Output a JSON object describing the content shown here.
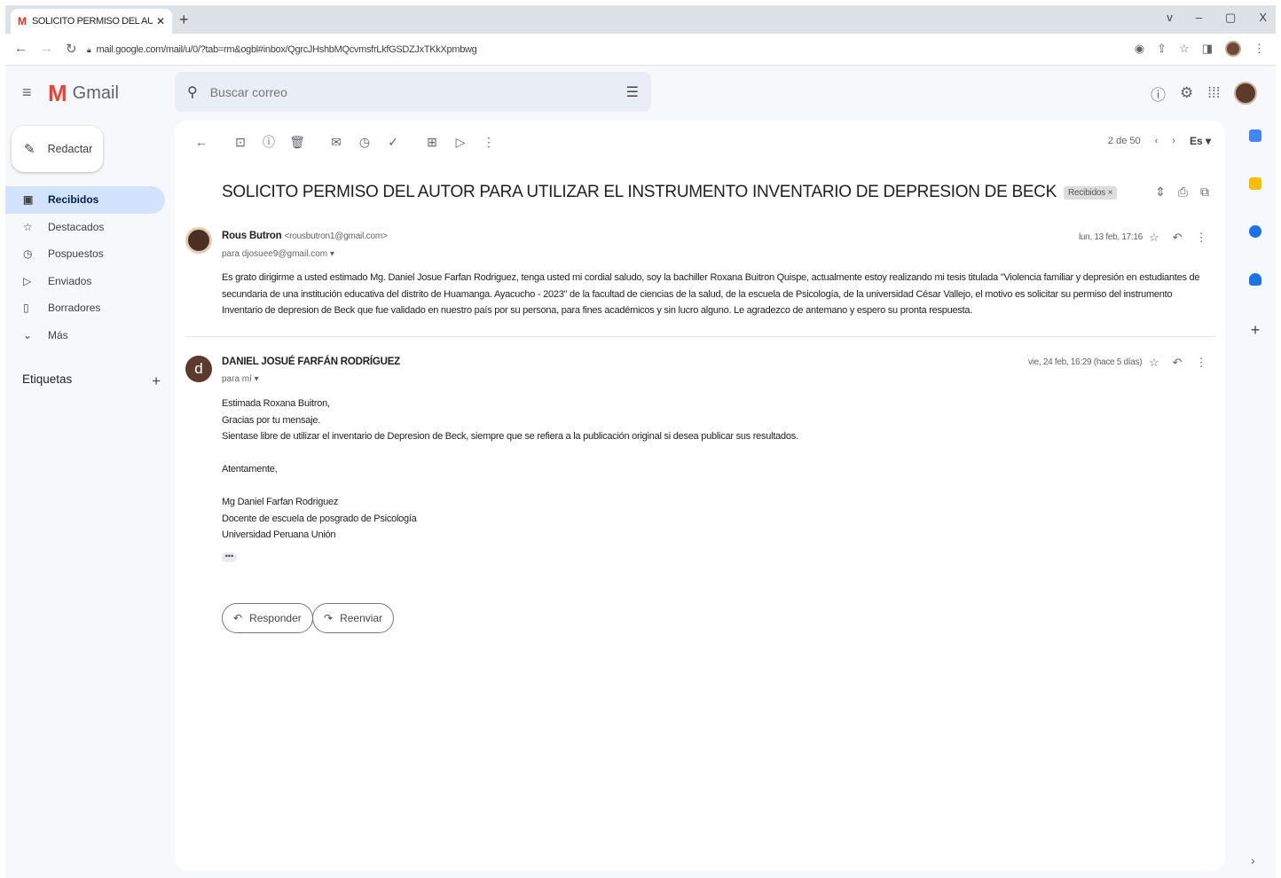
{
  "browser": {
    "tab_title": "SOLICITO PERMISO DEL AUTOR P",
    "tab_favicon": "M",
    "new_tab": "+",
    "url": "mail.google.com/mail/u/0/?tab=rm&ogbl#inbox/QgrcJHshbMQcvmsfrLkfGSDZJxTKkXpmbwg",
    "window_controls": [
      "v",
      "–",
      "▢",
      "X"
    ]
  },
  "gmail": {
    "logo_text": "Gmail",
    "search_placeholder": "Buscar correo",
    "compose_label": "Redactar"
  },
  "nav": [
    {
      "label": "Recibidos",
      "icon": "inbox-icon",
      "glyph": "▣",
      "active": true
    },
    {
      "label": "Destacados",
      "icon": "star-icon",
      "glyph": "☆"
    },
    {
      "label": "Pospuestos",
      "icon": "clock-icon",
      "glyph": "◷"
    },
    {
      "label": "Enviados",
      "icon": "send-icon",
      "glyph": "▷"
    },
    {
      "label": "Borradores",
      "icon": "draft-icon",
      "glyph": "▯"
    },
    {
      "label": "Más",
      "icon": "chevron-down-icon",
      "glyph": "⌄"
    }
  ],
  "labels_heading": "Etiquetas",
  "pager": {
    "text": "2 de 50",
    "lang": "Es ▾"
  },
  "thread": {
    "subject": "SOLICITO PERMISO DEL AUTOR PARA UTILIZAR EL INSTRUMENTO INVENTARIO DE DEPRESION DE BECK",
    "badge": "Recibidos ×",
    "messages": [
      {
        "sender": "Rous Butron",
        "email": "<rousbutron1@gmail.com>",
        "to": "para djosuee9@gmail.com ▾",
        "date": "lun, 13 feb, 17:16",
        "body": "Es grato dirigirme a usted estimado Mg. Daniel Josue Farfan Rodriguez, tenga usted mi cordial saludo, soy la bachiller Roxana Buitron Quispe, actualmente estoy realizando mi tesis titulada \"Violencia familiar y depresión en estudiantes de secundaria de una institución educativa del distrito de Huamanga. Ayacucho - 2023\" de la facultad de ciencias de la salud, de la escuela de Psicología, de la universidad César Vallejo, el motivo es solicitar su permiso del instrumento Inventario de depresion de Beck que fue validado en nuestro país por su persona, para fines académicos y sin lucro alguno. Le agradezco de antemano y espero su pronta respuesta."
      },
      {
        "avatar_letter": "d",
        "sender": "DANIEL JOSUÉ FARFÁN RODRÍGUEZ",
        "to": "para mí ▾",
        "date": "vie, 24 feb, 16:29 (hace 5 días)",
        "lines": [
          "Estimada Roxana Buitron,",
          "Gracias por tu mensaje.",
          "Sientase libre de utilizar el inventario de Depresion de Beck, siempre que se refiera a la publicación original si desea publicar sus resultados.",
          "",
          "Atentamente,",
          "",
          "Mg Daniel Farfan Rodriguez",
          "Docente de escuela de posgrado de Psicología",
          "Universidad Peruana Unión"
        ],
        "trimmed": "•••"
      }
    ]
  },
  "actions": {
    "reply": "Responder",
    "forward": "Reenviar"
  },
  "colors": {
    "accent": "#d3e3fd",
    "gmail_red": "#ea4335"
  }
}
